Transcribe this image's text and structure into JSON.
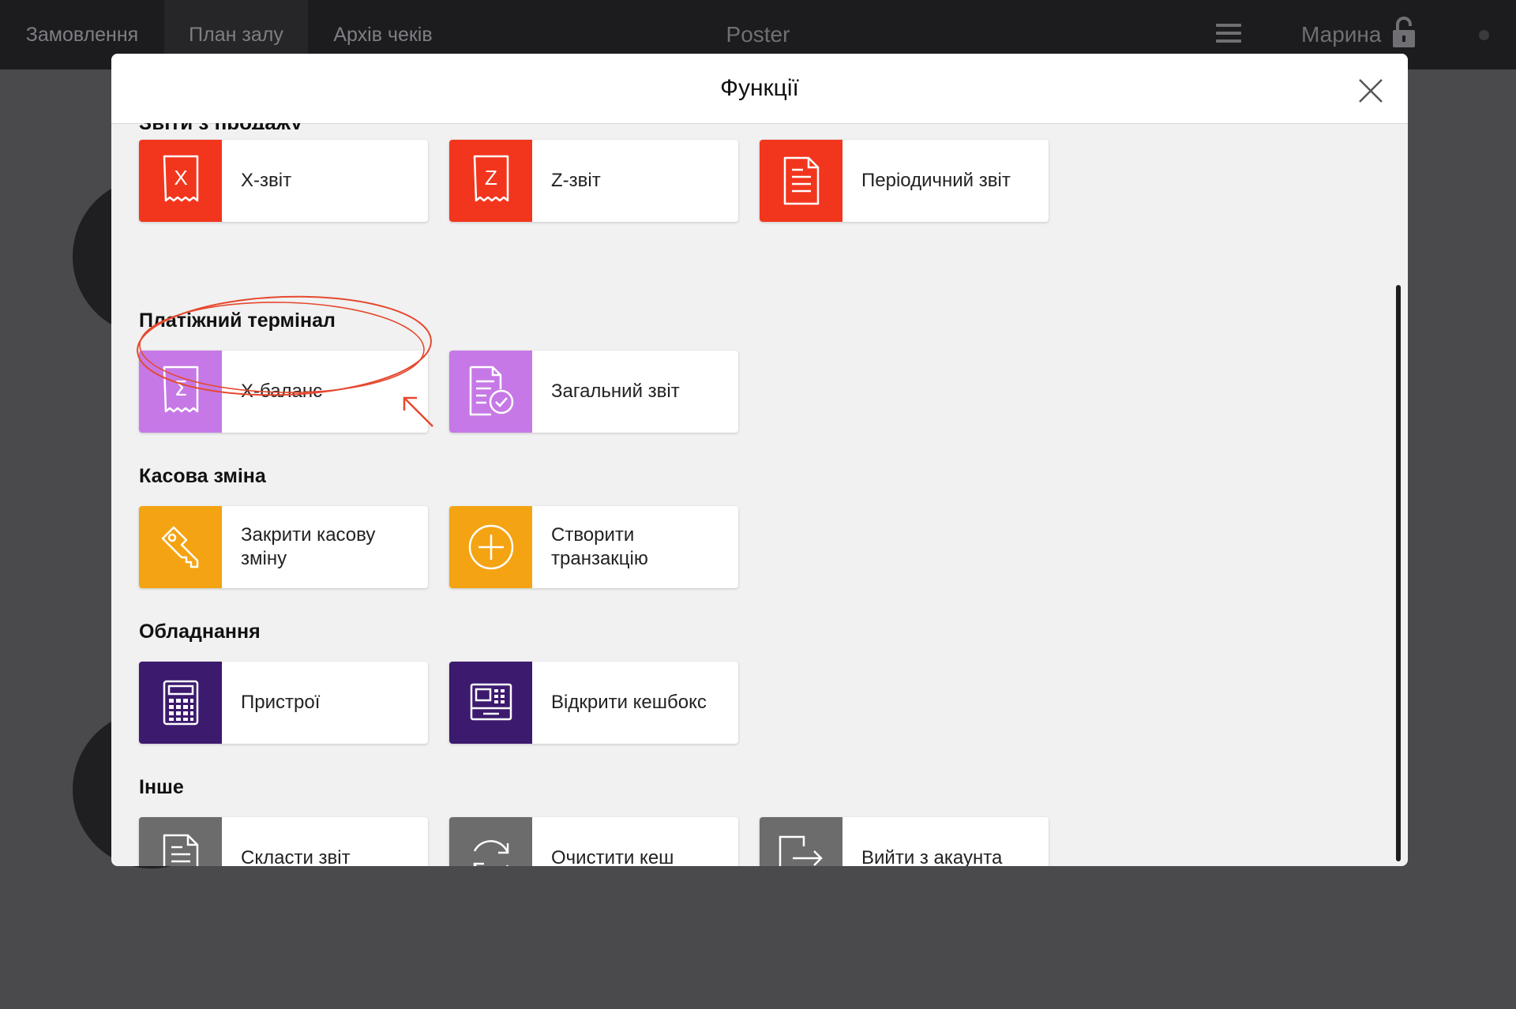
{
  "topbar": {
    "tabs": [
      "Замовлення",
      "План залу",
      "Архів чеків"
    ],
    "brand": "Poster",
    "user": "Марина"
  },
  "modal": {
    "title": "Функції",
    "partial_heading": "Звіти з продажу",
    "sections": [
      {
        "title": "Платіжний термінал"
      },
      {
        "title": "Касова зміна"
      },
      {
        "title": "Обладнання"
      },
      {
        "title": "Інше"
      }
    ],
    "cards": {
      "x_report": "X-звіт",
      "z_report": "Z-звіт",
      "periodic_report": "Періодичний звіт",
      "x_balance": "X-баланс",
      "general_report": "Загальний звіт",
      "close_shift": "Закрити касову зміну",
      "create_transaction": "Створити транзакцію",
      "devices": "Пристрої",
      "open_cashbox": "Відкрити кешбокс",
      "make_report": "Скласти звіт",
      "clear_cache": "Очистити кеш",
      "logout": "Вийти з акаунта"
    }
  },
  "colors": {
    "red": "#f2361e",
    "purple": "#c679e6",
    "orange": "#f4a312",
    "dark_purple": "#3c1a6e",
    "gray": "#6c6c6c",
    "annotation": "#e5492f"
  }
}
